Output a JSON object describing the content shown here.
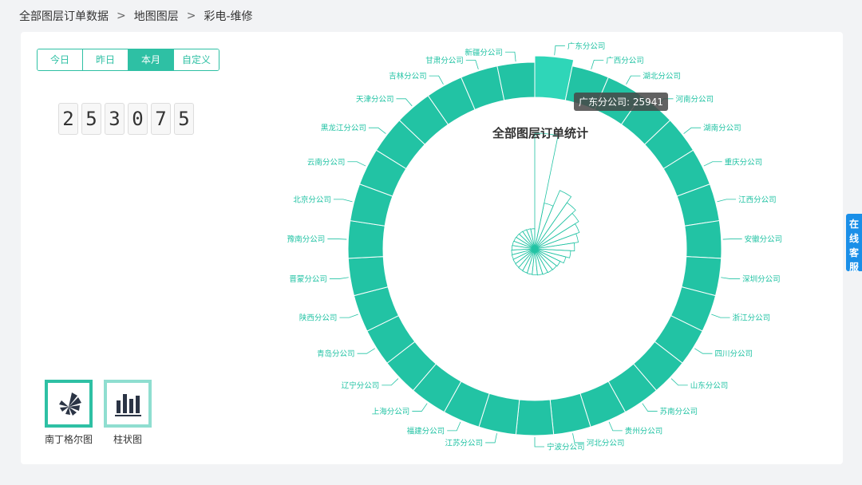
{
  "breadcrumb": {
    "items": [
      "全部图层订单数据",
      "地图图层",
      "彩电-维修"
    ],
    "separator": ">"
  },
  "tabs": [
    {
      "label": "今日",
      "active": false
    },
    {
      "label": "昨日",
      "active": false
    },
    {
      "label": "本月",
      "active": true
    },
    {
      "label": "自定义",
      "active": false
    }
  ],
  "counter": {
    "digits": [
      "2",
      "5",
      "3",
      "0",
      "7",
      "5"
    ]
  },
  "chart_buttons": [
    {
      "label": "南丁格尔图",
      "icon": "nightingale-rose-icon",
      "active": true
    },
    {
      "label": "柱状图",
      "icon": "bar-chart-icon",
      "active": false
    }
  ],
  "service": {
    "chars": [
      "在",
      "线",
      "客",
      "服"
    ]
  },
  "tooltip": {
    "text": "广东分公司: 25941"
  },
  "colors": {
    "accent": "#2ec0a4",
    "ring": "#22c3a4",
    "highlight": "#2fd6b8",
    "service": "#1a8fe8"
  },
  "chart_data": {
    "type": "pie",
    "style": "nightingale-rose",
    "title": "全部图层订单统计",
    "categories": [
      "广东分公司",
      "广西分公司",
      "湖北分公司",
      "河南分公司",
      "湖南分公司",
      "重庆分公司",
      "江西分公司",
      "安徽分公司",
      "深圳分公司",
      "浙江分公司",
      "四川分公司",
      "山东分公司",
      "苏南分公司",
      "贵州分公司",
      "河北分公司",
      "宁波分公司",
      "江苏分公司",
      "福建分公司",
      "上海分公司",
      "辽宁分公司",
      "青岛分公司",
      "陕西分公司",
      "晋蒙分公司",
      "豫南分公司",
      "北京分公司",
      "云南分公司",
      "黑龙江分公司",
      "天津分公司",
      "吉林分公司",
      "甘肃分公司",
      "新疆分公司"
    ],
    "values": [
      25941,
      8000,
      12400,
      10500,
      9300,
      8200,
      7300,
      6200,
      5200,
      4200,
      3200,
      3000,
      2900,
      2800,
      2700,
      2600,
      2500,
      2400,
      2300,
      2200,
      2100,
      2000,
      1900,
      1800,
      1700,
      1600,
      1500,
      1400,
      1300,
      1200,
      1100
    ],
    "highlighted": "广东分公司"
  }
}
